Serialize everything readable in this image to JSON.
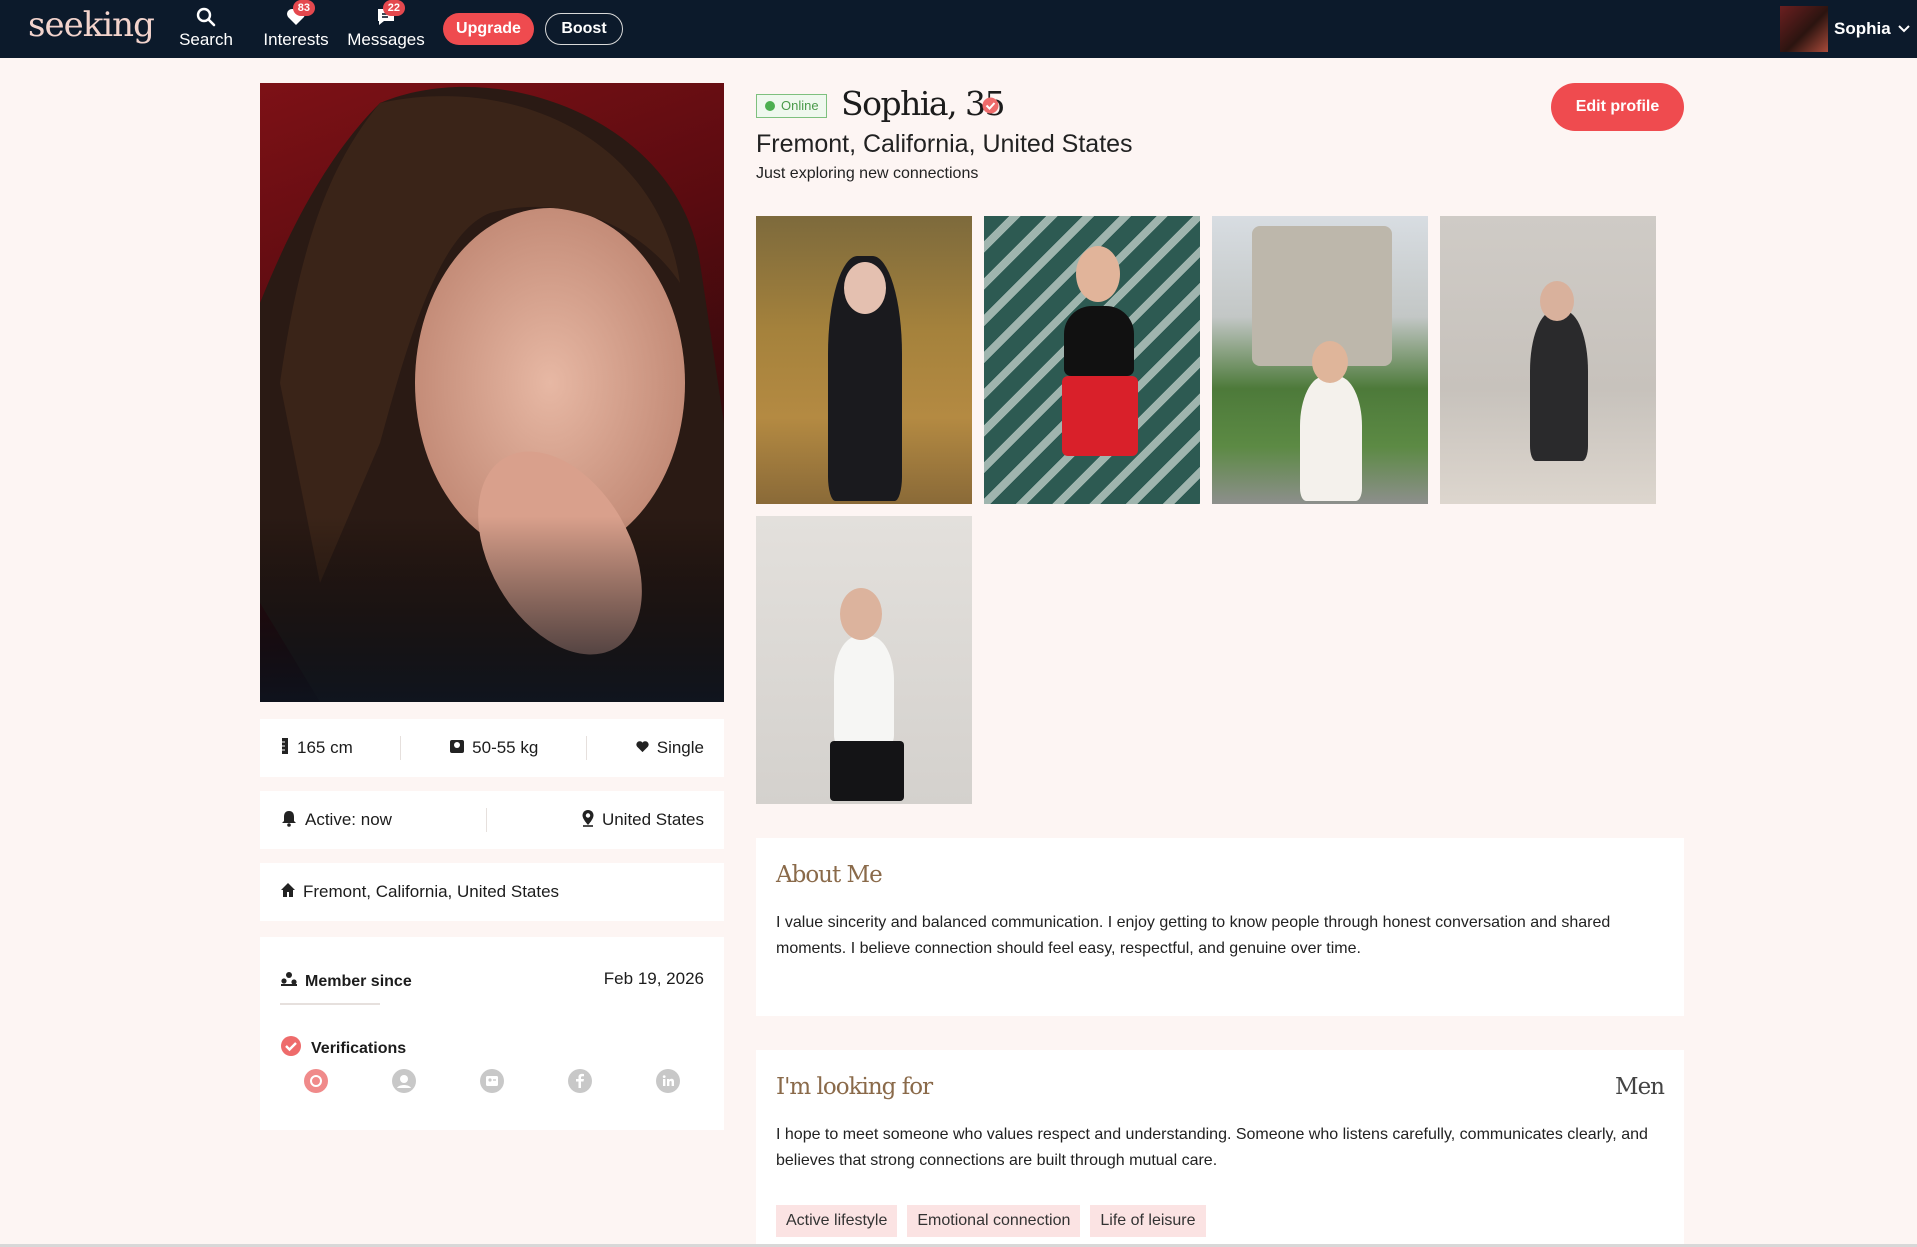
{
  "nav": {
    "logo": "seeking",
    "search_label": "Search",
    "interests_label": "Interests",
    "interests_count": "83",
    "messages_label": "Messages",
    "messages_count": "22",
    "upgrade_label": "Upgrade",
    "boost_label": "Boost",
    "user_name": "Sophia"
  },
  "profile": {
    "status": "Online",
    "name_age": "Sophia, 35",
    "location": "Fremont, California, United States",
    "tagline": "Just exploring new connections",
    "edit_label": "Edit profile"
  },
  "stats": {
    "height": "165 cm",
    "weight": "50-55 kg",
    "relationship": "Single",
    "active": "Active: now",
    "country": "United States",
    "home": "Fremont, California, United States",
    "member_since_label": "Member since",
    "member_since_date": "Feb 19, 2026",
    "verifications_label": "Verifications"
  },
  "about": {
    "title": "About Me",
    "text": "I value sincerity and balanced communication. I enjoy getting to know people through honest conversation and shared moments. I believe connection should feel easy, respectful, and genuine over time."
  },
  "looking_for": {
    "title": "I'm looking for",
    "target": "Men",
    "text": "I hope to meet someone who values respect and understanding. Someone who listens carefully, communicates clearly, and believes that strong connections are built through mutual care.",
    "tags": [
      "Active lifestyle",
      "Emotional connection",
      "Life of leisure"
    ]
  },
  "colors": {
    "nav_bg": "#0c1a2b",
    "accent": "#ef4b4f",
    "page_bg": "#fdf5f3",
    "online": "#4caf50",
    "section_title": "#8a6a4a"
  },
  "icons": [
    "search-icon",
    "heart-icon",
    "message-icon",
    "chevron-down-icon",
    "verified-icon",
    "ruler-icon",
    "scale-icon",
    "heart-icon",
    "bell-icon",
    "pin-icon",
    "home-icon",
    "members-icon",
    "check-circle-icon",
    "photo-verify-icon",
    "user-verify-icon",
    "id-verify-icon",
    "facebook-icon",
    "linkedin-icon"
  ]
}
